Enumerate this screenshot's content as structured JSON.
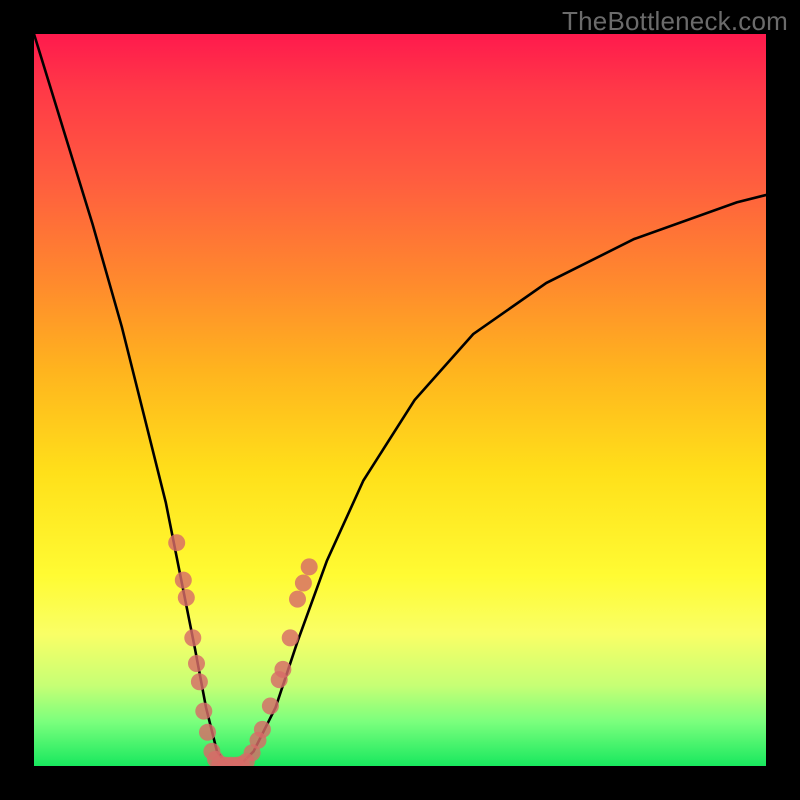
{
  "watermark": "TheBottleneck.com",
  "chart_data": {
    "type": "line",
    "title": "",
    "xlabel": "",
    "ylabel": "",
    "xlim": [
      0,
      100
    ],
    "ylim": [
      0,
      100
    ],
    "curve": {
      "name": "bottleneck-curve",
      "x": [
        0,
        4,
        8,
        12,
        15,
        18,
        20,
        22,
        23.5,
        25,
        26.5,
        28,
        30,
        33,
        36,
        40,
        45,
        52,
        60,
        70,
        82,
        96,
        100
      ],
      "y": [
        100,
        87,
        74,
        60,
        48,
        36,
        26,
        16,
        8,
        2,
        0,
        0,
        2,
        8,
        17,
        28,
        39,
        50,
        59,
        66,
        72,
        77,
        78
      ]
    },
    "series": [
      {
        "name": "left-branch-points",
        "type": "scatter",
        "x": [
          19.5,
          20.4,
          20.8,
          21.7,
          22.2,
          22.6,
          23.2,
          23.7,
          24.3,
          24.8,
          25.4
        ],
        "y": [
          30.5,
          25.4,
          23.0,
          17.5,
          14.0,
          11.5,
          7.5,
          4.6,
          2.0,
          0.9,
          0.3
        ]
      },
      {
        "name": "bottom-points",
        "type": "scatter",
        "x": [
          26.2,
          26.9,
          27.6,
          28.3,
          29.0
        ],
        "y": [
          0.1,
          0.1,
          0.1,
          0.2,
          0.6
        ]
      },
      {
        "name": "right-branch-points",
        "type": "scatter",
        "x": [
          29.8,
          30.6,
          31.2,
          32.3,
          33.5,
          34.0,
          35.0,
          36.0,
          36.8,
          37.6
        ],
        "y": [
          1.8,
          3.5,
          5.0,
          8.2,
          11.8,
          13.2,
          17.5,
          22.8,
          25.0,
          27.2
        ]
      }
    ]
  }
}
